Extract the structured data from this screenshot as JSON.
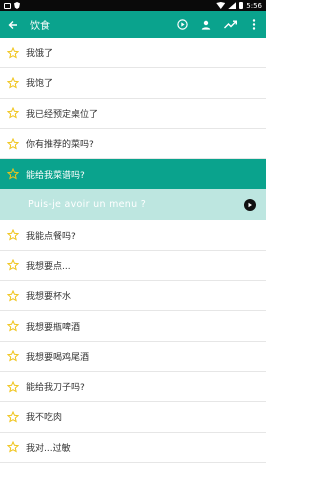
{
  "statusbar": {
    "time": "5:56"
  },
  "toolbar": {
    "title": "饮食",
    "back_icon": "arrow-left-icon",
    "actions": [
      "play-circle-icon",
      "person-icon",
      "trending-up-icon",
      "more-vert-icon"
    ]
  },
  "phrases": [
    {
      "label": "我饿了"
    },
    {
      "label": "我饱了"
    },
    {
      "label": "我已经预定桌位了"
    },
    {
      "label": "你有推荐的菜吗?"
    },
    {
      "label": "能给我菜谱吗?",
      "selected": true
    },
    {
      "label": "我能点餐吗?"
    },
    {
      "label": "我想要点..."
    },
    {
      "label": "我想要杯水"
    },
    {
      "label": "我想要瓶啤酒"
    },
    {
      "label": "我想要喝鸡尾酒"
    },
    {
      "label": "能给我刀子吗?"
    },
    {
      "label": "我不吃肉"
    },
    {
      "label": "我对...过敏"
    }
  ],
  "translation": {
    "text": "Puis-je avoir un menu ?",
    "icon": "play-icon"
  },
  "colors": {
    "accent": "#0aa38d",
    "translation_bg": "#bde6e0",
    "star": "#f0c419"
  }
}
